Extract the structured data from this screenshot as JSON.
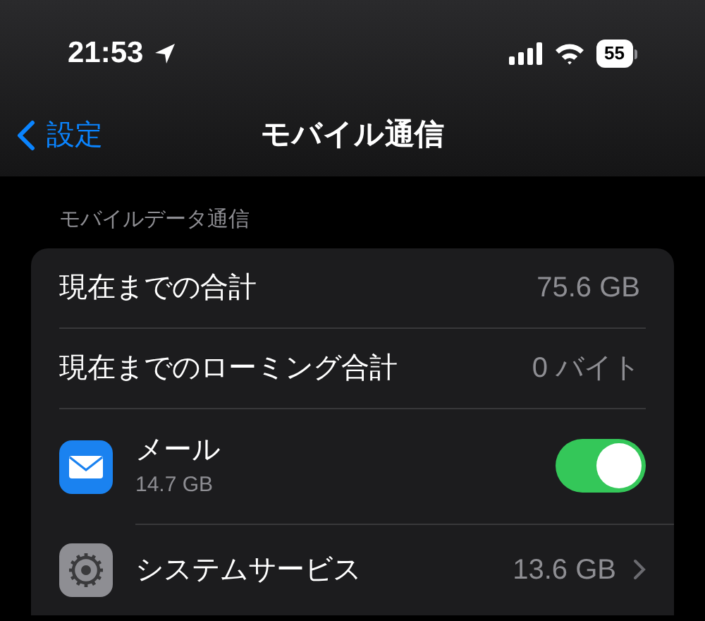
{
  "status_bar": {
    "time": "21:53",
    "battery": "55"
  },
  "nav": {
    "back": "設定",
    "title": "モバイル通信"
  },
  "section": {
    "header": "モバイルデータ通信",
    "rows": [
      {
        "kind": "value",
        "label": "現在までの合計",
        "value": "75.6 GB"
      },
      {
        "kind": "value",
        "label": "現在までのローミング合計",
        "value": "0 バイト"
      },
      {
        "kind": "app_toggle",
        "label": "メール",
        "detail": "14.7 GB",
        "on": true
      },
      {
        "kind": "service",
        "label": "システムサービス",
        "value": "13.6 GB"
      }
    ]
  }
}
